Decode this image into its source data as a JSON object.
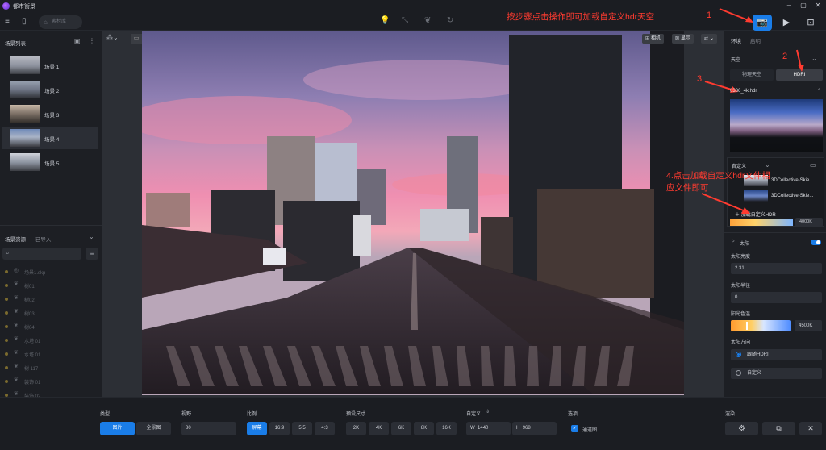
{
  "app": {
    "title": "都市街景"
  },
  "topbar": {
    "project_label": "素材库",
    "annotation_main": "按步骤点击操作即可加载自定义hdr天空",
    "annotation_num_1": "1",
    "annotation_num_2": "2",
    "annotation_num_3": "3",
    "annotation_step4_line1": "4.点击加载自定义hdr文件相",
    "annotation_step4_line2": "应文件即可"
  },
  "left_panel": {
    "scene_list_title": "场景列表",
    "scenes": [
      {
        "label": "场景 1"
      },
      {
        "label": "场景 2"
      },
      {
        "label": "场景 3"
      },
      {
        "label": "场景 4"
      },
      {
        "label": "场景 5"
      }
    ],
    "resources_tab": "场景资源",
    "imported_tab": "已导入",
    "resources": [
      {
        "label": "场景1.skp"
      },
      {
        "label": "树01"
      },
      {
        "label": "树02"
      },
      {
        "label": "树03"
      },
      {
        "label": "树04"
      },
      {
        "label": "水塔 01"
      },
      {
        "label": "水塔 01"
      },
      {
        "label": "树 117"
      },
      {
        "label": "装饰 01"
      },
      {
        "label": "装饰 02"
      }
    ]
  },
  "viewport": {
    "camera_btn": "相机",
    "display_btn": "显示"
  },
  "right_panel": {
    "tab_env": "环境",
    "tab_light": "启明",
    "sky_label": "天空",
    "seg_physical": "物理天空",
    "seg_hdri": "HDRI",
    "hdr_filename": "0386_4k.hdr",
    "custom_label": "自定义",
    "hdr_files": [
      "3DCollective-Skie...",
      "3DCollective-Skie..."
    ],
    "load_custom": "加载自定义HDR",
    "color_temp_right": "4000K",
    "sun_label": "太阳",
    "sun_brightness_label": "太阳亮度",
    "sun_brightness_value": "2.31",
    "sun_radius_label": "太阳半径",
    "sun_radius_value": "0",
    "sun_color_label": "阳光色温",
    "sun_color_value": "4500K",
    "sun_direction_label": "太阳方向",
    "follow_hdri": "跟随HDRI",
    "custom_dir": "自定义"
  },
  "bottombar": {
    "type_label": "类型",
    "type_photo": "图片",
    "type_panorama": "全景图",
    "view_label": "视野",
    "view_value": "80",
    "ratio_label": "比例",
    "ratios": [
      "屏幕",
      "16:9",
      "5:5",
      "4:3"
    ],
    "preset_label": "预设尺寸",
    "presets": [
      "2K",
      "4K",
      "6K",
      "8K",
      "16K"
    ],
    "custom_label": "自定义",
    "width_label": "W",
    "width_value": "1440",
    "height_label": "H",
    "height_value": "968",
    "options_label": "选项",
    "option_check": "✓",
    "option_label": "通道图",
    "render_label": "渲染"
  }
}
